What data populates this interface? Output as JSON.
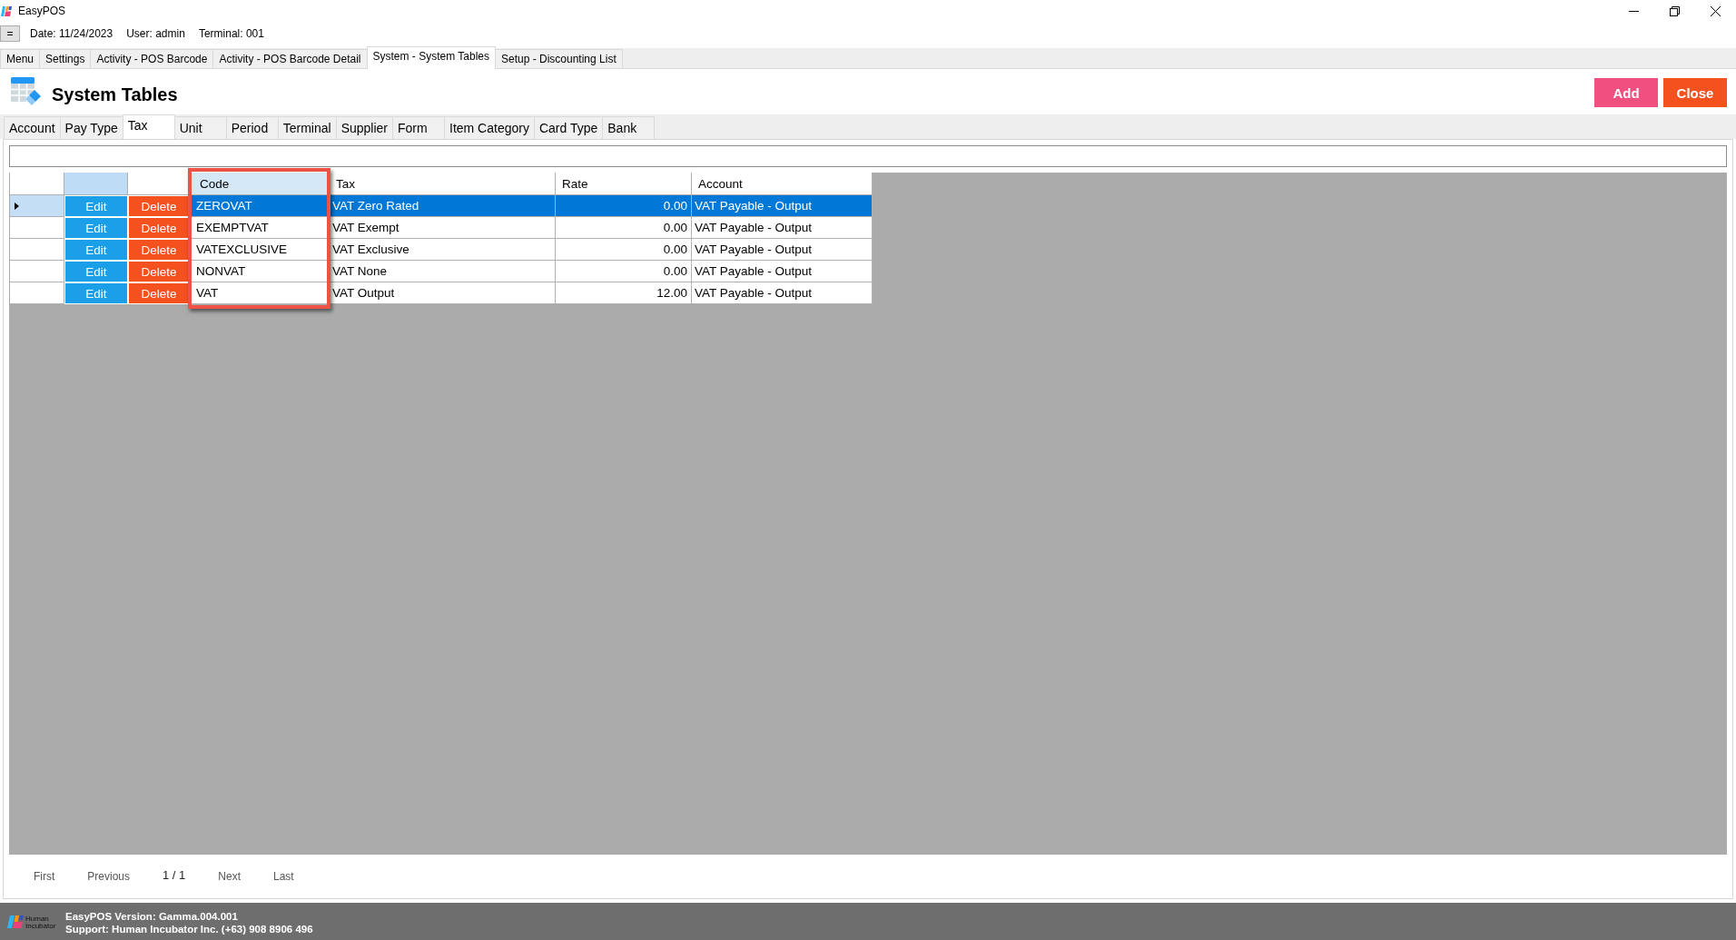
{
  "window": {
    "title": "EasyPOS"
  },
  "info_bar": {
    "menu_button": "=",
    "date": "Date: 11/24/2023",
    "user": "User: admin",
    "terminal": "Terminal: 001"
  },
  "document_tabs": [
    {
      "label": "Menu",
      "selected": false
    },
    {
      "label": "Settings",
      "selected": false
    },
    {
      "label": "Activity - POS Barcode",
      "selected": false
    },
    {
      "label": "Activity - POS Barcode Detail",
      "selected": false
    },
    {
      "label": "System - System Tables",
      "selected": true
    },
    {
      "label": "Setup - Discounting List",
      "selected": false
    }
  ],
  "header": {
    "title": "System Tables",
    "buttons": [
      {
        "label": "Add",
        "kind": "add"
      },
      {
        "label": "Close",
        "kind": "close"
      }
    ]
  },
  "table_tabs": [
    {
      "label": "Account",
      "selected": false
    },
    {
      "label": "Pay Type",
      "selected": false
    },
    {
      "label": "Tax",
      "selected": true
    },
    {
      "label": "Unit",
      "selected": false
    },
    {
      "label": "Period",
      "selected": false
    },
    {
      "label": "Terminal",
      "selected": false
    },
    {
      "label": "Supplier",
      "selected": false
    },
    {
      "label": "Form",
      "selected": false
    },
    {
      "label": "Item Category",
      "selected": false
    },
    {
      "label": "Card Type",
      "selected": false
    },
    {
      "label": "Bank",
      "selected": false
    }
  ],
  "grid": {
    "action_columns": [
      {
        "kind": "edit",
        "selected": true
      },
      {
        "kind": "delete",
        "selected": false
      }
    ],
    "columns": [
      {
        "label": "Code",
        "kind": "text",
        "highlighted": true
      },
      {
        "label": "Tax",
        "kind": "text",
        "highlighted": false
      },
      {
        "label": "Rate",
        "kind": "number",
        "highlighted": false
      },
      {
        "label": "Account",
        "kind": "text",
        "highlighted": false
      }
    ],
    "rows": [
      {
        "selected": true,
        "actions": [
          "Edit",
          "Delete"
        ],
        "cells": [
          "ZEROVAT",
          "VAT Zero Rated",
          "0.00",
          "VAT Payable - Output"
        ]
      },
      {
        "selected": false,
        "actions": [
          "Edit",
          "Delete"
        ],
        "cells": [
          "EXEMPTVAT",
          "VAT Exempt",
          "0.00",
          "VAT Payable - Output"
        ]
      },
      {
        "selected": false,
        "actions": [
          "Edit",
          "Delete"
        ],
        "cells": [
          "VATEXCLUSIVE",
          "VAT Exclusive",
          "0.00",
          "VAT Payable - Output"
        ]
      },
      {
        "selected": false,
        "actions": [
          "Edit",
          "Delete"
        ],
        "cells": [
          "NONVAT",
          "VAT None",
          "0.00",
          "VAT Payable - Output"
        ]
      },
      {
        "selected": false,
        "actions": [
          "Edit",
          "Delete"
        ],
        "cells": [
          "VAT",
          "VAT Output",
          "12.00",
          "VAT Payable - Output"
        ]
      }
    ]
  },
  "pagination": {
    "first": "First",
    "previous": "Previous",
    "page": "1 / 1",
    "next": "Next",
    "last": "Last"
  },
  "footer": {
    "logo_text": "Human Incubator",
    "version": "EasyPOS Version: Gamma.004.001",
    "support": "Support: Human Incubator Inc. (+63) 908 8906 496"
  }
}
